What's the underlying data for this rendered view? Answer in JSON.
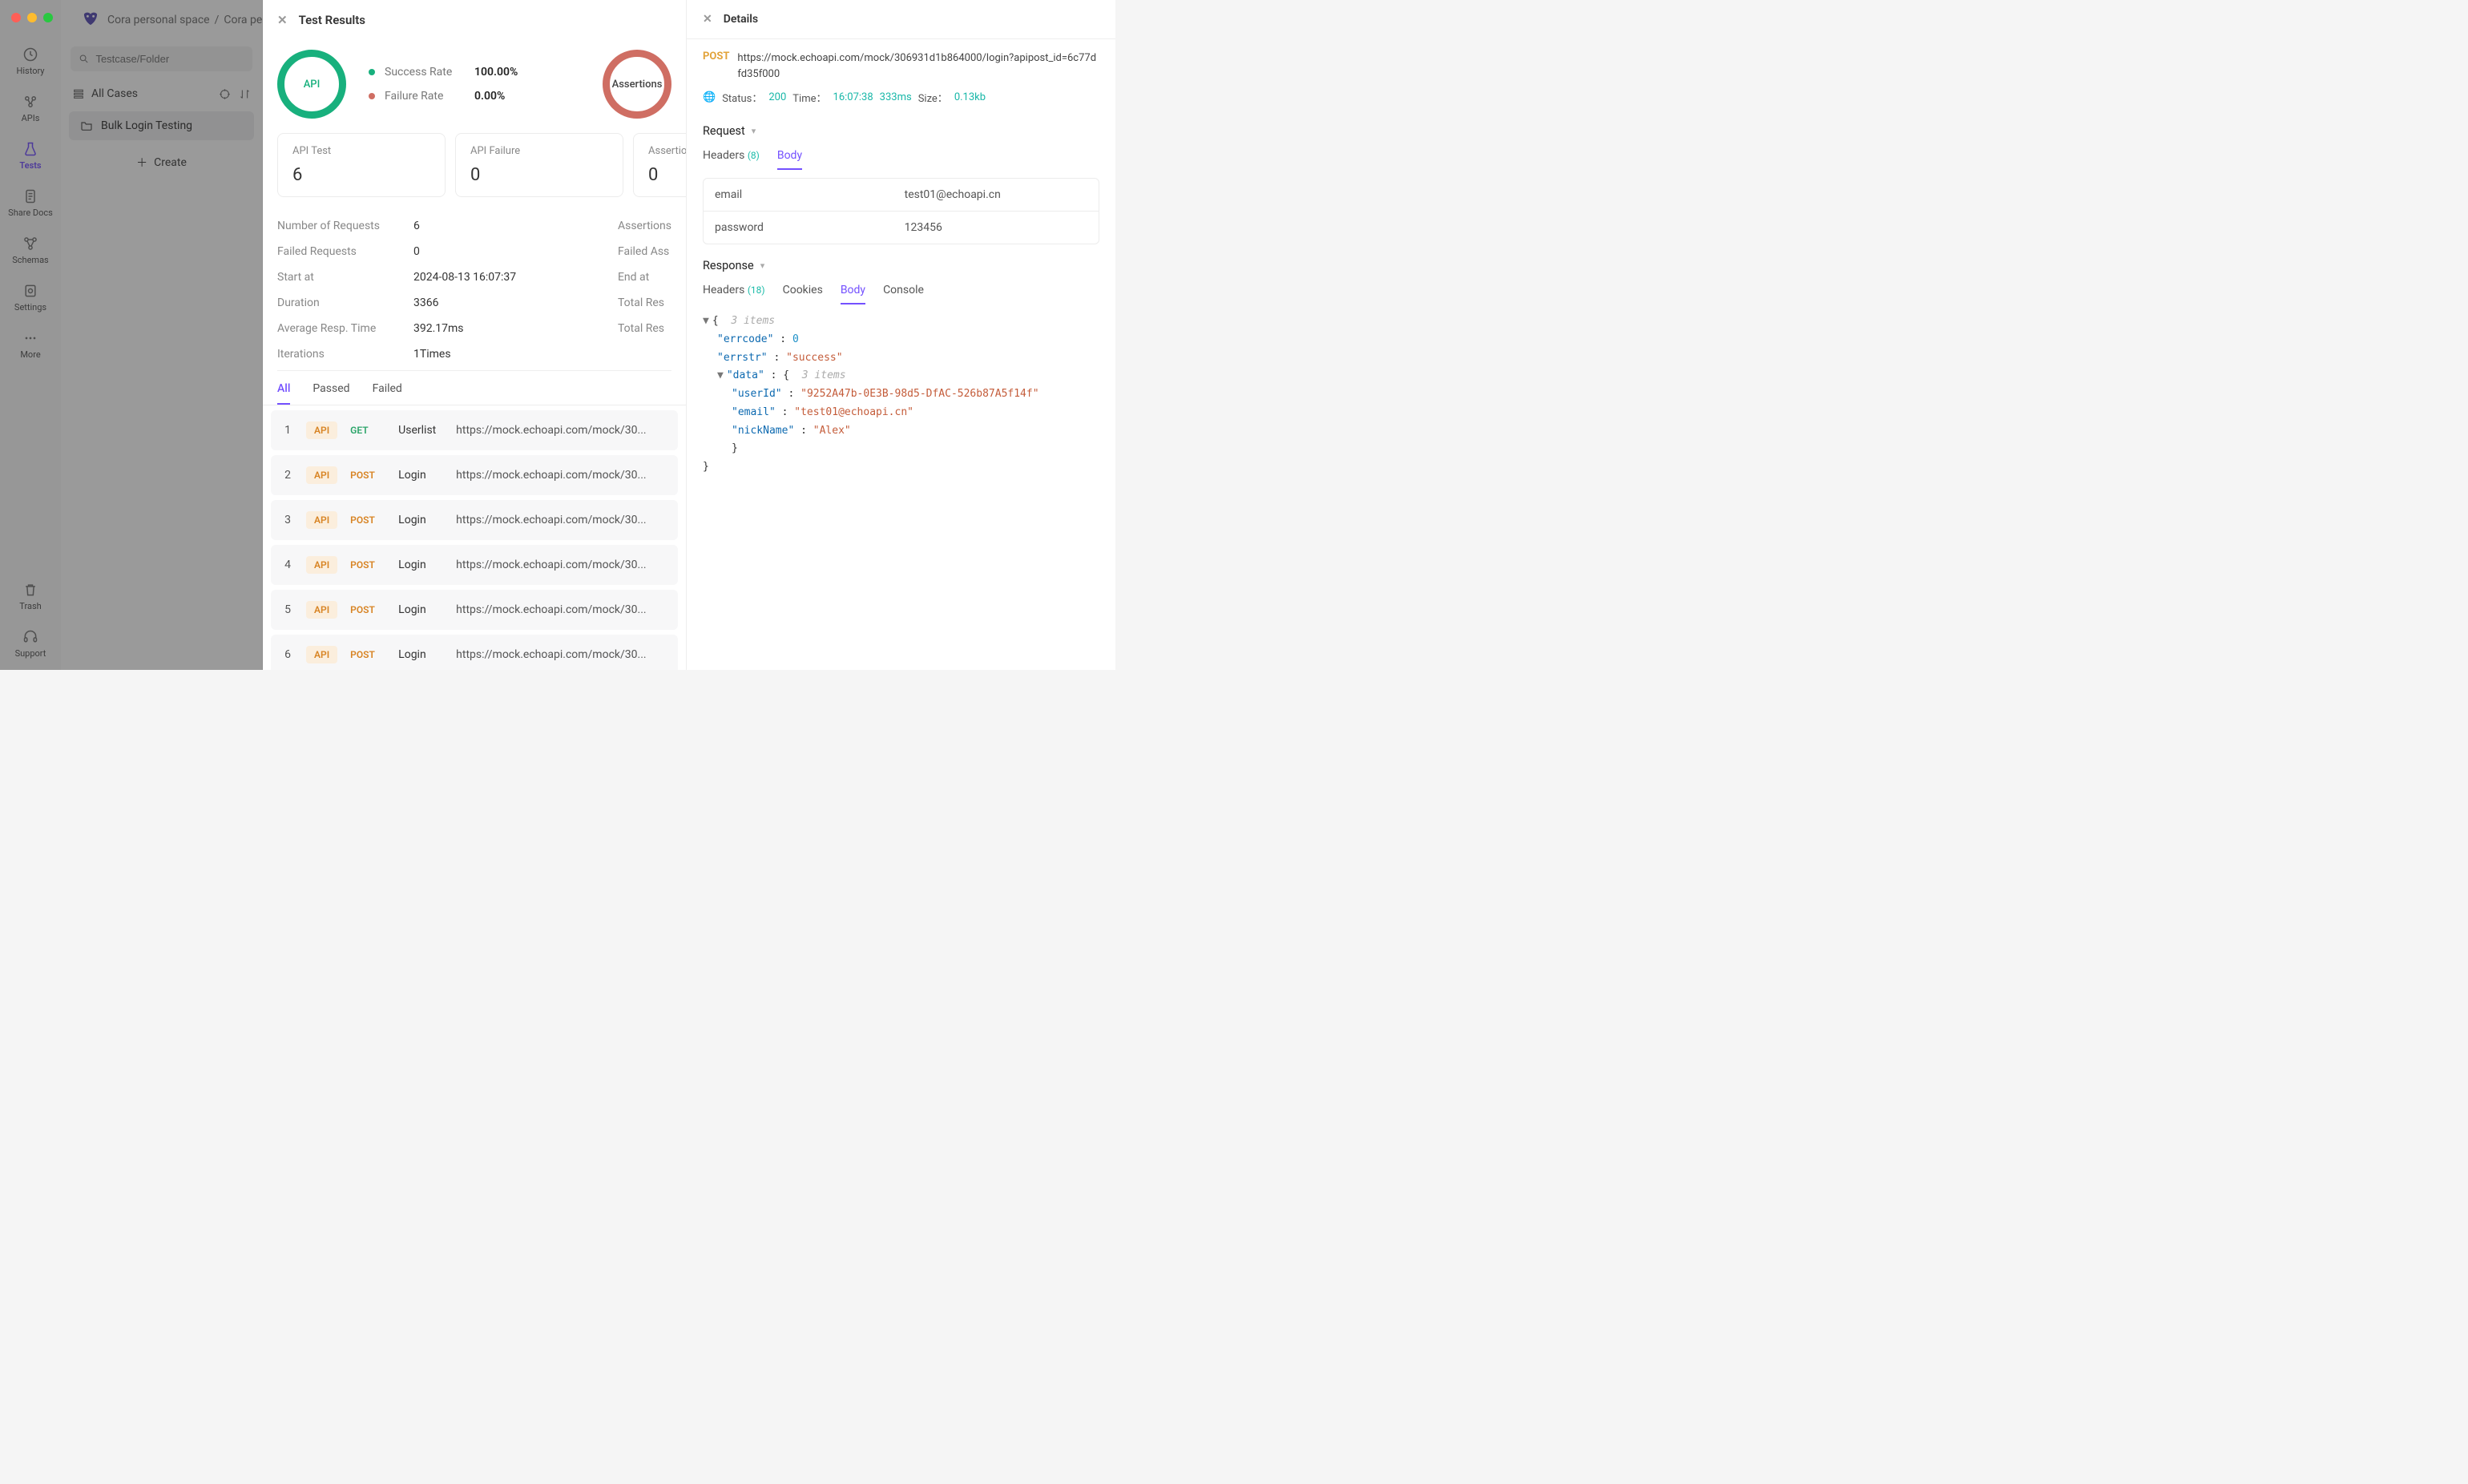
{
  "breadcrumbs": [
    "Cora personal space",
    "Cora persona"
  ],
  "sidebar": {
    "items": [
      {
        "label": "History"
      },
      {
        "label": "APIs"
      },
      {
        "label": "Tests"
      },
      {
        "label": "Share Docs"
      },
      {
        "label": "Schemas"
      },
      {
        "label": "Settings"
      },
      {
        "label": "More"
      }
    ],
    "bottom": [
      {
        "label": "Trash"
      },
      {
        "label": "Support"
      }
    ]
  },
  "caselist": {
    "search_placeholder": "Testcase/Folder",
    "all_cases": "All Cases",
    "folder": "Bulk Login Testing",
    "create": "Create"
  },
  "results": {
    "title": "Test Results",
    "donuts": {
      "api": "API",
      "assertions": "Assertions"
    },
    "rates": [
      {
        "label": "Success Rate",
        "value": "100.00%",
        "color": "#18b07d"
      },
      {
        "label": "Failure Rate",
        "value": "0.00%",
        "color": "#cf6e63"
      }
    ],
    "cards": [
      {
        "title": "API Test",
        "value": "6"
      },
      {
        "title": "API Failure",
        "value": "0"
      },
      {
        "title": "Assertions",
        "value": "0"
      }
    ],
    "left_kv": [
      {
        "k": "Number of Requests",
        "v": "6"
      },
      {
        "k": "Failed Requests",
        "v": "0"
      },
      {
        "k": "Start at",
        "v": "2024-08-13 16:07:37"
      },
      {
        "k": "Duration",
        "v": "3366"
      },
      {
        "k": "Average Resp. Time",
        "v": "392.17ms"
      },
      {
        "k": "Iterations",
        "v": "1Times"
      }
    ],
    "right_kv": [
      {
        "k": "Assertions",
        "v": ""
      },
      {
        "k": "Failed Ass",
        "v": ""
      },
      {
        "k": "End at",
        "v": ""
      },
      {
        "k": "Total Res",
        "v": ""
      },
      {
        "k": "Total Res",
        "v": ""
      }
    ],
    "tabs": [
      "All",
      "Passed",
      "Failed"
    ],
    "rows": [
      {
        "idx": "1",
        "badge": "API",
        "method": "GET",
        "name": "Userlist",
        "url": "https://mock.echoapi.com/mock/30..."
      },
      {
        "idx": "2",
        "badge": "API",
        "method": "POST",
        "name": "Login",
        "url": "https://mock.echoapi.com/mock/30..."
      },
      {
        "idx": "3",
        "badge": "API",
        "method": "POST",
        "name": "Login",
        "url": "https://mock.echoapi.com/mock/30..."
      },
      {
        "idx": "4",
        "badge": "API",
        "method": "POST",
        "name": "Login",
        "url": "https://mock.echoapi.com/mock/30..."
      },
      {
        "idx": "5",
        "badge": "API",
        "method": "POST",
        "name": "Login",
        "url": "https://mock.echoapi.com/mock/30..."
      },
      {
        "idx": "6",
        "badge": "API",
        "method": "POST",
        "name": "Login",
        "url": "https://mock.echoapi.com/mock/30..."
      }
    ]
  },
  "details": {
    "title": "Details",
    "method": "POST",
    "url": "https://mock.echoapi.com/mock/306931d1b864000/login?apipost_id=6c77dfd35f000",
    "status_label": "Status：",
    "status_code": "200",
    "time_label": "Time：",
    "time_value": "16:07:38",
    "duration": "333ms",
    "size_label": "Size：",
    "size_value": "0.13kb",
    "request_head": "Request",
    "request_tabs": {
      "headers": "Headers",
      "headers_cnt": "(8)",
      "body": "Body"
    },
    "request_body": [
      {
        "k": "email",
        "v": "test01@echoapi.cn"
      },
      {
        "k": "password",
        "v": "123456"
      }
    ],
    "response_head": "Response",
    "response_tabs": {
      "headers": "Headers",
      "headers_cnt": "(18)",
      "cookies": "Cookies",
      "body": "Body",
      "console": "Console"
    },
    "json_meta_root": "3 items",
    "json_meta_data": "3 items",
    "json": {
      "errcode": 0,
      "errstr": "success",
      "data": {
        "userId": "9252A47b-0E3B-98d5-DfAC-526b87A5f14f",
        "email": "test01@echoapi.cn",
        "nickName": "Alex"
      }
    }
  }
}
